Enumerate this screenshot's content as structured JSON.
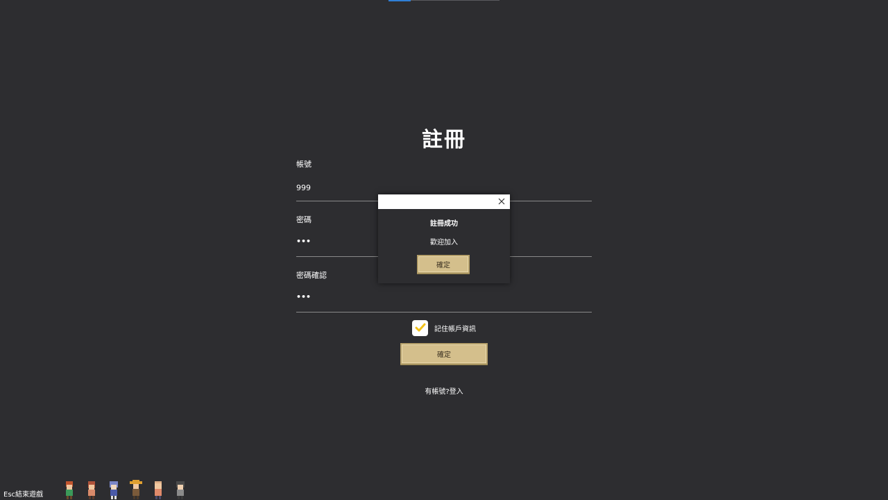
{
  "page": {
    "title": "註冊"
  },
  "form": {
    "account": {
      "label": "帳號",
      "value": "999"
    },
    "password": {
      "label": "密碼",
      "value": "•••"
    },
    "password_confirm": {
      "label": "密碼確認",
      "value": "•••"
    },
    "remember": {
      "label": "記住帳戶資訊",
      "checked": true
    },
    "submit_label": "確定",
    "login_link": "有帳號?登入"
  },
  "footer": {
    "exit_hint": "Esc結束遊戲",
    "characters": [
      "character-red-hair",
      "character-brown-hair",
      "character-blue-hair",
      "character-straw-hat",
      "character-bald",
      "character-dark-hair"
    ]
  },
  "modal": {
    "title": "註冊成功",
    "message": "歡迎加入",
    "confirm_label": "確定"
  },
  "colors": {
    "background": "#2d2d30",
    "button_gold": "#d4bf8c",
    "checkbox_check": "#f2c21a",
    "accent_blue": "#2f7fd6"
  }
}
